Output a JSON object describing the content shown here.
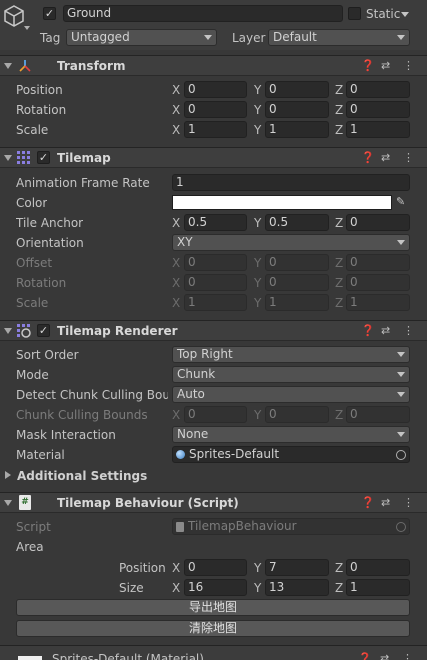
{
  "gameobject": {
    "name": "Ground",
    "active": true,
    "static_label": "Static",
    "tag_label": "Tag",
    "tag_value": "Untagged",
    "layer_label": "Layer",
    "layer_value": "Default"
  },
  "transform": {
    "title": "Transform",
    "position_label": "Position",
    "position": {
      "x": "0",
      "y": "0",
      "z": "0"
    },
    "rotation_label": "Rotation",
    "rotation": {
      "x": "0",
      "y": "0",
      "z": "0"
    },
    "scale_label": "Scale",
    "scale": {
      "x": "1",
      "y": "1",
      "z": "1"
    }
  },
  "axes": {
    "x": "X",
    "y": "Y",
    "z": "Z"
  },
  "tilemap": {
    "title": "Tilemap",
    "anim_rate_label": "Animation Frame Rate",
    "anim_rate": "1",
    "color_label": "Color",
    "color_value": "#ffffff",
    "anchor_label": "Tile Anchor",
    "anchor": {
      "x": "0.5",
      "y": "0.5",
      "z": "0"
    },
    "orientation_label": "Orientation",
    "orientation": "XY",
    "offset_label": "Offset",
    "offset": {
      "x": "0",
      "y": "0",
      "z": "0"
    },
    "rotation_label": "Rotation",
    "rotation": {
      "x": "0",
      "y": "0",
      "z": "0"
    },
    "scale_label": "Scale",
    "scale": {
      "x": "1",
      "y": "1",
      "z": "1"
    }
  },
  "renderer": {
    "title": "Tilemap Renderer",
    "sort_order_label": "Sort Order",
    "sort_order": "Top Right",
    "mode_label": "Mode",
    "mode": "Chunk",
    "detect_label": "Detect Chunk Culling Boun",
    "detect": "Auto",
    "chunk_bounds_label": "Chunk Culling Bounds",
    "chunk_bounds": {
      "x": "0",
      "y": "0",
      "z": "0"
    },
    "mask_label": "Mask Interaction",
    "mask": "None",
    "material_label": "Material",
    "material": "Sprites-Default",
    "additional_label": "Additional Settings"
  },
  "behaviour": {
    "title": "Tilemap Behaviour (Script)",
    "script_label": "Script",
    "script": "TilemapBehaviour",
    "area_label": "Area",
    "position_label": "Position",
    "position": {
      "x": "0",
      "y": "7",
      "z": "0"
    },
    "size_label": "Size",
    "size": {
      "x": "16",
      "y": "13",
      "z": "1"
    },
    "export_button": "导出地图",
    "clear_button": "清除地图"
  },
  "footer": {
    "material_title": "Sprites-Default (Material)"
  },
  "colors": {
    "background": "#383838",
    "header": "#3e3e3e",
    "field": "#2a2a2a",
    "dropdown": "#515151",
    "button": "#585858"
  }
}
